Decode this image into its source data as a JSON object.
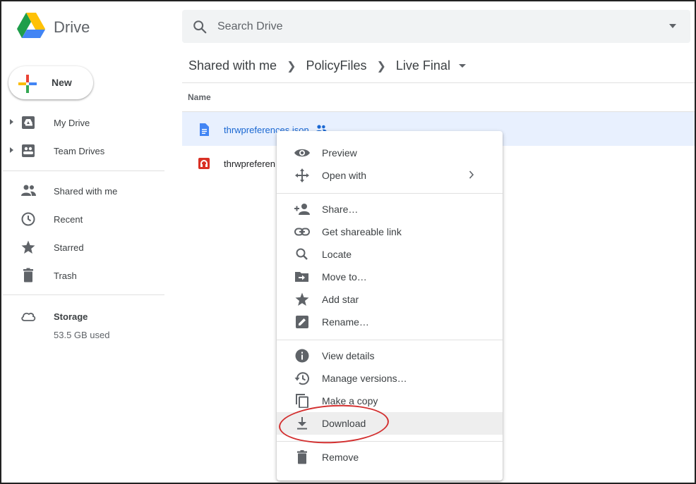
{
  "app": {
    "name": "Drive"
  },
  "search": {
    "placeholder": "Search Drive"
  },
  "new_button": {
    "label": "New"
  },
  "sidebar": {
    "items": [
      {
        "label": "My Drive",
        "icon": "my-drive-icon"
      },
      {
        "label": "Team Drives",
        "icon": "team-drives-icon"
      },
      {
        "label": "Shared with me",
        "icon": "shared-people-icon"
      },
      {
        "label": "Recent",
        "icon": "clock-icon"
      },
      {
        "label": "Starred",
        "icon": "star-icon"
      },
      {
        "label": "Trash",
        "icon": "trash-icon"
      }
    ],
    "storage": {
      "label": "Storage",
      "used": "53.5 GB used",
      "icon": "cloud-icon"
    }
  },
  "breadcrumb": [
    "Shared with me",
    "PolicyFiles",
    "Live Final"
  ],
  "file_list": {
    "column_header": "Name",
    "files": [
      {
        "name": "thrwpreferences.json",
        "selected": true,
        "shared": true,
        "icon": "document-icon"
      },
      {
        "name": "thrwpreferen",
        "selected": false,
        "shared": false,
        "icon": "red-app-icon"
      }
    ]
  },
  "context_menu": {
    "items": [
      {
        "label": "Preview",
        "icon": "eye-icon"
      },
      {
        "label": "Open with",
        "icon": "move-arrows-icon",
        "submenu": true
      },
      {
        "label": "Share…",
        "icon": "add-person-icon"
      },
      {
        "label": "Get shareable link",
        "icon": "link-icon"
      },
      {
        "label": "Locate",
        "icon": "search-icon"
      },
      {
        "label": "Move to…",
        "icon": "folder-move-icon"
      },
      {
        "label": "Add star",
        "icon": "star-icon"
      },
      {
        "label": "Rename…",
        "icon": "pencil-icon"
      },
      {
        "label": "View details",
        "icon": "info-icon"
      },
      {
        "label": "Manage versions…",
        "icon": "history-icon"
      },
      {
        "label": "Make a copy",
        "icon": "copy-icon"
      },
      {
        "label": "Download",
        "icon": "download-icon",
        "highlighted": true
      },
      {
        "label": "Remove",
        "icon": "trash-icon"
      }
    ]
  },
  "colors": {
    "selected_row": "#e8f0fe",
    "selected_text": "#1967d2",
    "annotation_circle": "#d32f2f",
    "menu_highlight": "#eeeeee"
  }
}
